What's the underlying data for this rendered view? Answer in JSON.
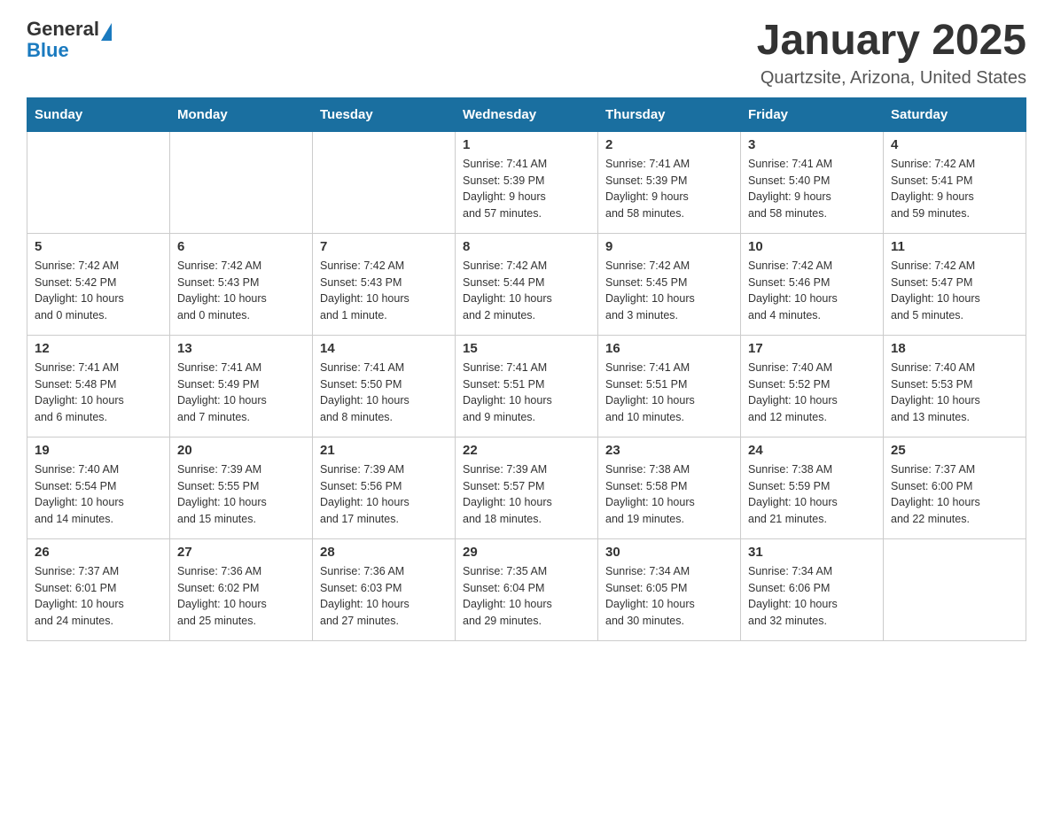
{
  "header": {
    "logo_general": "General",
    "logo_blue": "Blue",
    "month_title": "January 2025",
    "location": "Quartzsite, Arizona, United States"
  },
  "weekdays": [
    "Sunday",
    "Monday",
    "Tuesday",
    "Wednesday",
    "Thursday",
    "Friday",
    "Saturday"
  ],
  "weeks": [
    [
      {
        "day": "",
        "info": ""
      },
      {
        "day": "",
        "info": ""
      },
      {
        "day": "",
        "info": ""
      },
      {
        "day": "1",
        "info": "Sunrise: 7:41 AM\nSunset: 5:39 PM\nDaylight: 9 hours\nand 57 minutes."
      },
      {
        "day": "2",
        "info": "Sunrise: 7:41 AM\nSunset: 5:39 PM\nDaylight: 9 hours\nand 58 minutes."
      },
      {
        "day": "3",
        "info": "Sunrise: 7:41 AM\nSunset: 5:40 PM\nDaylight: 9 hours\nand 58 minutes."
      },
      {
        "day": "4",
        "info": "Sunrise: 7:42 AM\nSunset: 5:41 PM\nDaylight: 9 hours\nand 59 minutes."
      }
    ],
    [
      {
        "day": "5",
        "info": "Sunrise: 7:42 AM\nSunset: 5:42 PM\nDaylight: 10 hours\nand 0 minutes."
      },
      {
        "day": "6",
        "info": "Sunrise: 7:42 AM\nSunset: 5:43 PM\nDaylight: 10 hours\nand 0 minutes."
      },
      {
        "day": "7",
        "info": "Sunrise: 7:42 AM\nSunset: 5:43 PM\nDaylight: 10 hours\nand 1 minute."
      },
      {
        "day": "8",
        "info": "Sunrise: 7:42 AM\nSunset: 5:44 PM\nDaylight: 10 hours\nand 2 minutes."
      },
      {
        "day": "9",
        "info": "Sunrise: 7:42 AM\nSunset: 5:45 PM\nDaylight: 10 hours\nand 3 minutes."
      },
      {
        "day": "10",
        "info": "Sunrise: 7:42 AM\nSunset: 5:46 PM\nDaylight: 10 hours\nand 4 minutes."
      },
      {
        "day": "11",
        "info": "Sunrise: 7:42 AM\nSunset: 5:47 PM\nDaylight: 10 hours\nand 5 minutes."
      }
    ],
    [
      {
        "day": "12",
        "info": "Sunrise: 7:41 AM\nSunset: 5:48 PM\nDaylight: 10 hours\nand 6 minutes."
      },
      {
        "day": "13",
        "info": "Sunrise: 7:41 AM\nSunset: 5:49 PM\nDaylight: 10 hours\nand 7 minutes."
      },
      {
        "day": "14",
        "info": "Sunrise: 7:41 AM\nSunset: 5:50 PM\nDaylight: 10 hours\nand 8 minutes."
      },
      {
        "day": "15",
        "info": "Sunrise: 7:41 AM\nSunset: 5:51 PM\nDaylight: 10 hours\nand 9 minutes."
      },
      {
        "day": "16",
        "info": "Sunrise: 7:41 AM\nSunset: 5:51 PM\nDaylight: 10 hours\nand 10 minutes."
      },
      {
        "day": "17",
        "info": "Sunrise: 7:40 AM\nSunset: 5:52 PM\nDaylight: 10 hours\nand 12 minutes."
      },
      {
        "day": "18",
        "info": "Sunrise: 7:40 AM\nSunset: 5:53 PM\nDaylight: 10 hours\nand 13 minutes."
      }
    ],
    [
      {
        "day": "19",
        "info": "Sunrise: 7:40 AM\nSunset: 5:54 PM\nDaylight: 10 hours\nand 14 minutes."
      },
      {
        "day": "20",
        "info": "Sunrise: 7:39 AM\nSunset: 5:55 PM\nDaylight: 10 hours\nand 15 minutes."
      },
      {
        "day": "21",
        "info": "Sunrise: 7:39 AM\nSunset: 5:56 PM\nDaylight: 10 hours\nand 17 minutes."
      },
      {
        "day": "22",
        "info": "Sunrise: 7:39 AM\nSunset: 5:57 PM\nDaylight: 10 hours\nand 18 minutes."
      },
      {
        "day": "23",
        "info": "Sunrise: 7:38 AM\nSunset: 5:58 PM\nDaylight: 10 hours\nand 19 minutes."
      },
      {
        "day": "24",
        "info": "Sunrise: 7:38 AM\nSunset: 5:59 PM\nDaylight: 10 hours\nand 21 minutes."
      },
      {
        "day": "25",
        "info": "Sunrise: 7:37 AM\nSunset: 6:00 PM\nDaylight: 10 hours\nand 22 minutes."
      }
    ],
    [
      {
        "day": "26",
        "info": "Sunrise: 7:37 AM\nSunset: 6:01 PM\nDaylight: 10 hours\nand 24 minutes."
      },
      {
        "day": "27",
        "info": "Sunrise: 7:36 AM\nSunset: 6:02 PM\nDaylight: 10 hours\nand 25 minutes."
      },
      {
        "day": "28",
        "info": "Sunrise: 7:36 AM\nSunset: 6:03 PM\nDaylight: 10 hours\nand 27 minutes."
      },
      {
        "day": "29",
        "info": "Sunrise: 7:35 AM\nSunset: 6:04 PM\nDaylight: 10 hours\nand 29 minutes."
      },
      {
        "day": "30",
        "info": "Sunrise: 7:34 AM\nSunset: 6:05 PM\nDaylight: 10 hours\nand 30 minutes."
      },
      {
        "day": "31",
        "info": "Sunrise: 7:34 AM\nSunset: 6:06 PM\nDaylight: 10 hours\nand 32 minutes."
      },
      {
        "day": "",
        "info": ""
      }
    ]
  ]
}
